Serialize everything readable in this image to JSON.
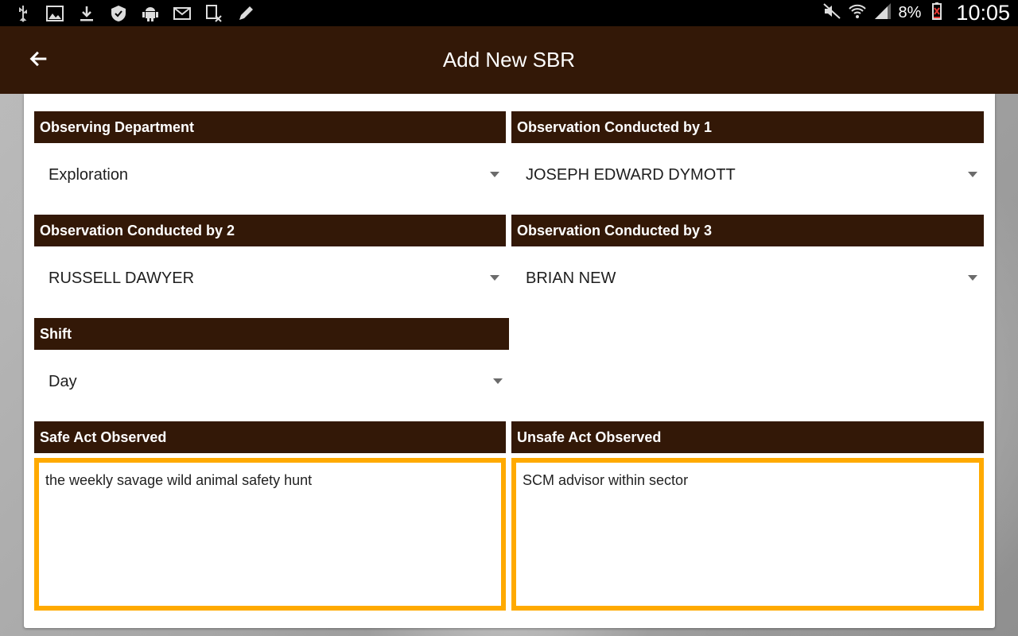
{
  "status_bar": {
    "left_icons": [
      "usb-icon",
      "image-icon",
      "download-icon",
      "shield-icon",
      "android-icon",
      "mail-icon",
      "file-x-icon",
      "edit-icon"
    ],
    "right_icons": [
      "mute-icon",
      "wifi-icon",
      "signal-icon",
      "battery-icon"
    ],
    "battery": "8%",
    "time": "10:05"
  },
  "app_bar": {
    "title": "Add New SBR",
    "back_icon": "arrow-left-icon"
  },
  "form": {
    "observing_department": {
      "label": "Observing Department",
      "value": "Exploration"
    },
    "conducted_by_1": {
      "label": "Observation Conducted by 1",
      "value": "JOSEPH EDWARD DYMOTT"
    },
    "conducted_by_2": {
      "label": "Observation Conducted by 2",
      "value": "RUSSELL DAWYER"
    },
    "conducted_by_3": {
      "label": "Observation Conducted by 3",
      "value": "BRIAN NEW"
    },
    "shift": {
      "label": "Shift",
      "value": "Day"
    },
    "safe_act": {
      "label": "Safe Act Observed",
      "value": "the weekly savage wild animal safety hunt"
    },
    "unsafe_act": {
      "label": "Unsafe Act Observed",
      "value": "SCM advisor within sector"
    }
  },
  "colors": {
    "header_bg": "#331807",
    "focus_border": "#ffaa00"
  }
}
